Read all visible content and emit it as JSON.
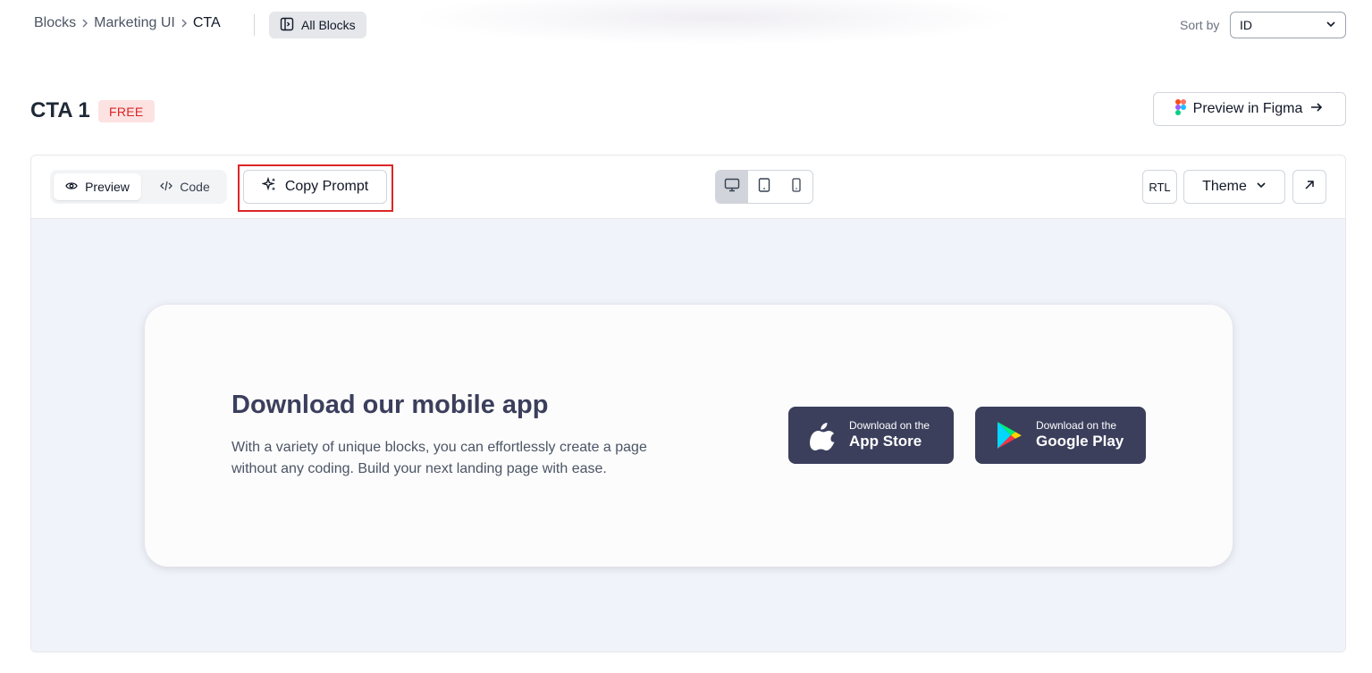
{
  "topbar": {
    "breadcrumb": [
      "Blocks",
      "Marketing UI",
      "CTA"
    ],
    "all_blocks_label": "All Blocks",
    "sort_by_label": "Sort by",
    "sort_value": "ID"
  },
  "header": {
    "title": "CTA 1",
    "badge": "FREE",
    "figma_button": "Preview in Figma"
  },
  "toolbar": {
    "preview_tab": "Preview",
    "code_tab": "Code",
    "copy_prompt": "Copy Prompt",
    "devices": [
      "desktop-icon",
      "tablet-icon",
      "mobile-icon"
    ],
    "active_device": "desktop-icon",
    "rtl": "RTL",
    "theme": "Theme"
  },
  "cta": {
    "title": "Download our mobile app",
    "description": "With a variety of unique blocks, you can effortlessly create a page without any coding. Build your next landing page with ease.",
    "app_store": {
      "small": "Download on the",
      "big": "App Store"
    },
    "google_play": {
      "small": "Download on the",
      "big": "Google Play"
    }
  },
  "colors": {
    "accent_dark": "#3b3f5c",
    "badge_red": "#dc2626",
    "canvas_bg": "#f1f3fb",
    "highlight": "#dc2626"
  }
}
